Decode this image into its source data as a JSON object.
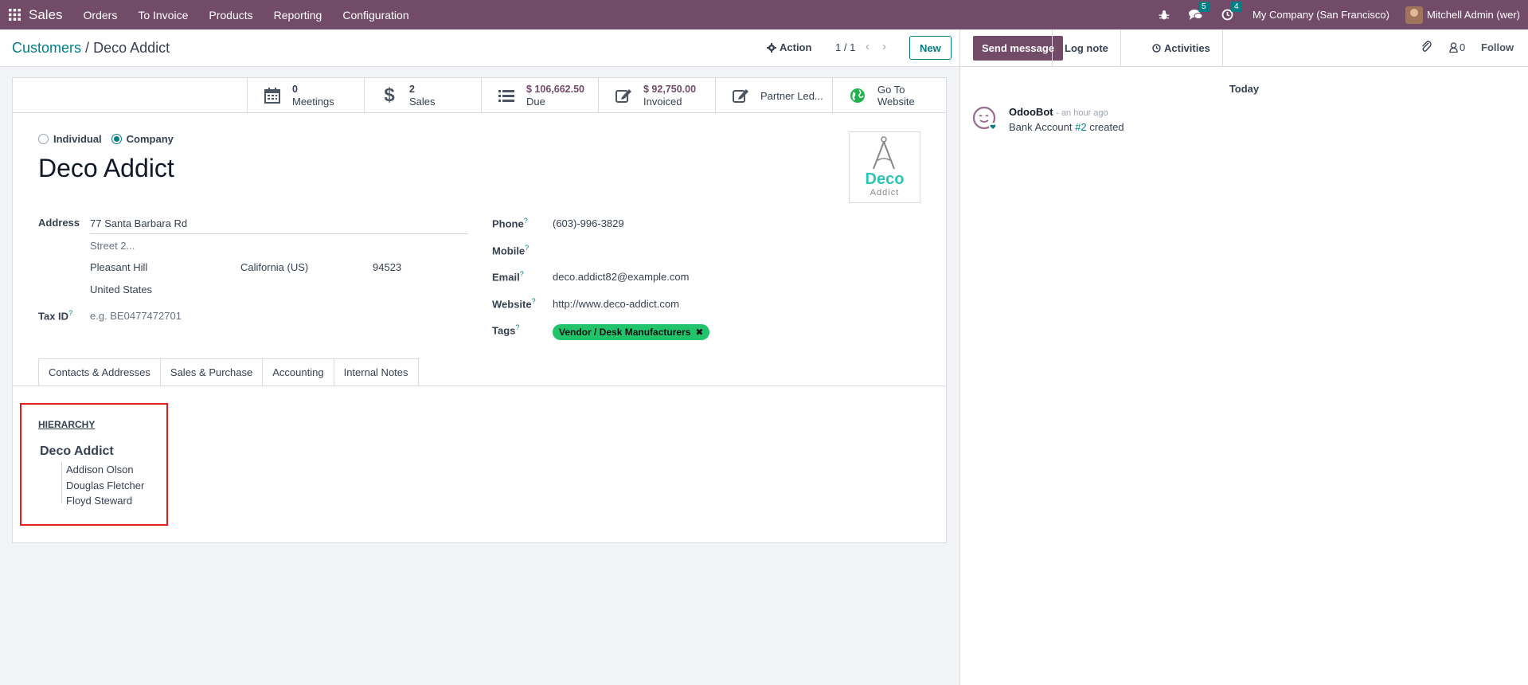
{
  "topbar": {
    "app_name": "Sales",
    "menu": [
      "Orders",
      "To Invoice",
      "Products",
      "Reporting",
      "Configuration"
    ],
    "messages_count": "5",
    "activities_count": "4",
    "company": "My Company (San Francisco)",
    "user": "Mitchell Admin (wer)"
  },
  "control": {
    "breadcrumb_parent": "Customers",
    "breadcrumb_sep": "/",
    "breadcrumb_current": "Deco Addict",
    "action_label": "Action",
    "pager": "1 / 1",
    "new_label": "New"
  },
  "smart_buttons": {
    "meetings": {
      "value": "0",
      "label": "Meetings"
    },
    "sales": {
      "value": "2",
      "label": "Sales"
    },
    "due": {
      "value": "$ 106,662.50",
      "label": "Due"
    },
    "invoiced": {
      "value": "$ 92,750.00",
      "label": "Invoiced"
    },
    "ledger": {
      "label": "Partner Led..."
    },
    "website": {
      "value": "Go To",
      "label": "Website"
    }
  },
  "form": {
    "type_individual": "Individual",
    "type_company": "Company",
    "name": "Deco Addict",
    "logo_text_main": "Deco",
    "logo_text_sub": "Addict",
    "address_label": "Address",
    "street": "77 Santa Barbara Rd",
    "street2_placeholder": "Street 2...",
    "city": "Pleasant Hill",
    "state": "California (US)",
    "zip": "94523",
    "country": "United States",
    "tax_id_label": "Tax ID",
    "tax_id_placeholder": "e.g. BE0477472701",
    "phone_label": "Phone",
    "phone": "(603)-996-3829",
    "mobile_label": "Mobile",
    "email_label": "Email",
    "email": "deco.addict82@example.com",
    "website_label": "Website",
    "website": "http://www.deco-addict.com",
    "tags_label": "Tags",
    "tag": "Vendor / Desk Manufacturers",
    "help_mark": "?"
  },
  "tabs": [
    "Contacts & Addresses",
    "Sales & Purchase",
    "Accounting",
    "Internal Notes"
  ],
  "hierarchy": {
    "title": "HIERARCHY",
    "root": "Deco Addict",
    "children": [
      "Addison Olson",
      "Douglas Fletcher",
      "Floyd Steward"
    ]
  },
  "chatter": {
    "send_message": "Send message",
    "log_note": "Log note",
    "activities": "Activities",
    "followers_count": "0",
    "follow": "Follow",
    "today": "Today",
    "author": "OdooBot",
    "time": "- an hour ago",
    "msg_prefix": "Bank Account",
    "msg_link": "#2",
    "msg_suffix": "created"
  },
  "colors": {
    "brand": "#714b67",
    "accent": "#017e84",
    "tag_green": "#21c46b",
    "highlight_red": "#e11d1d"
  }
}
